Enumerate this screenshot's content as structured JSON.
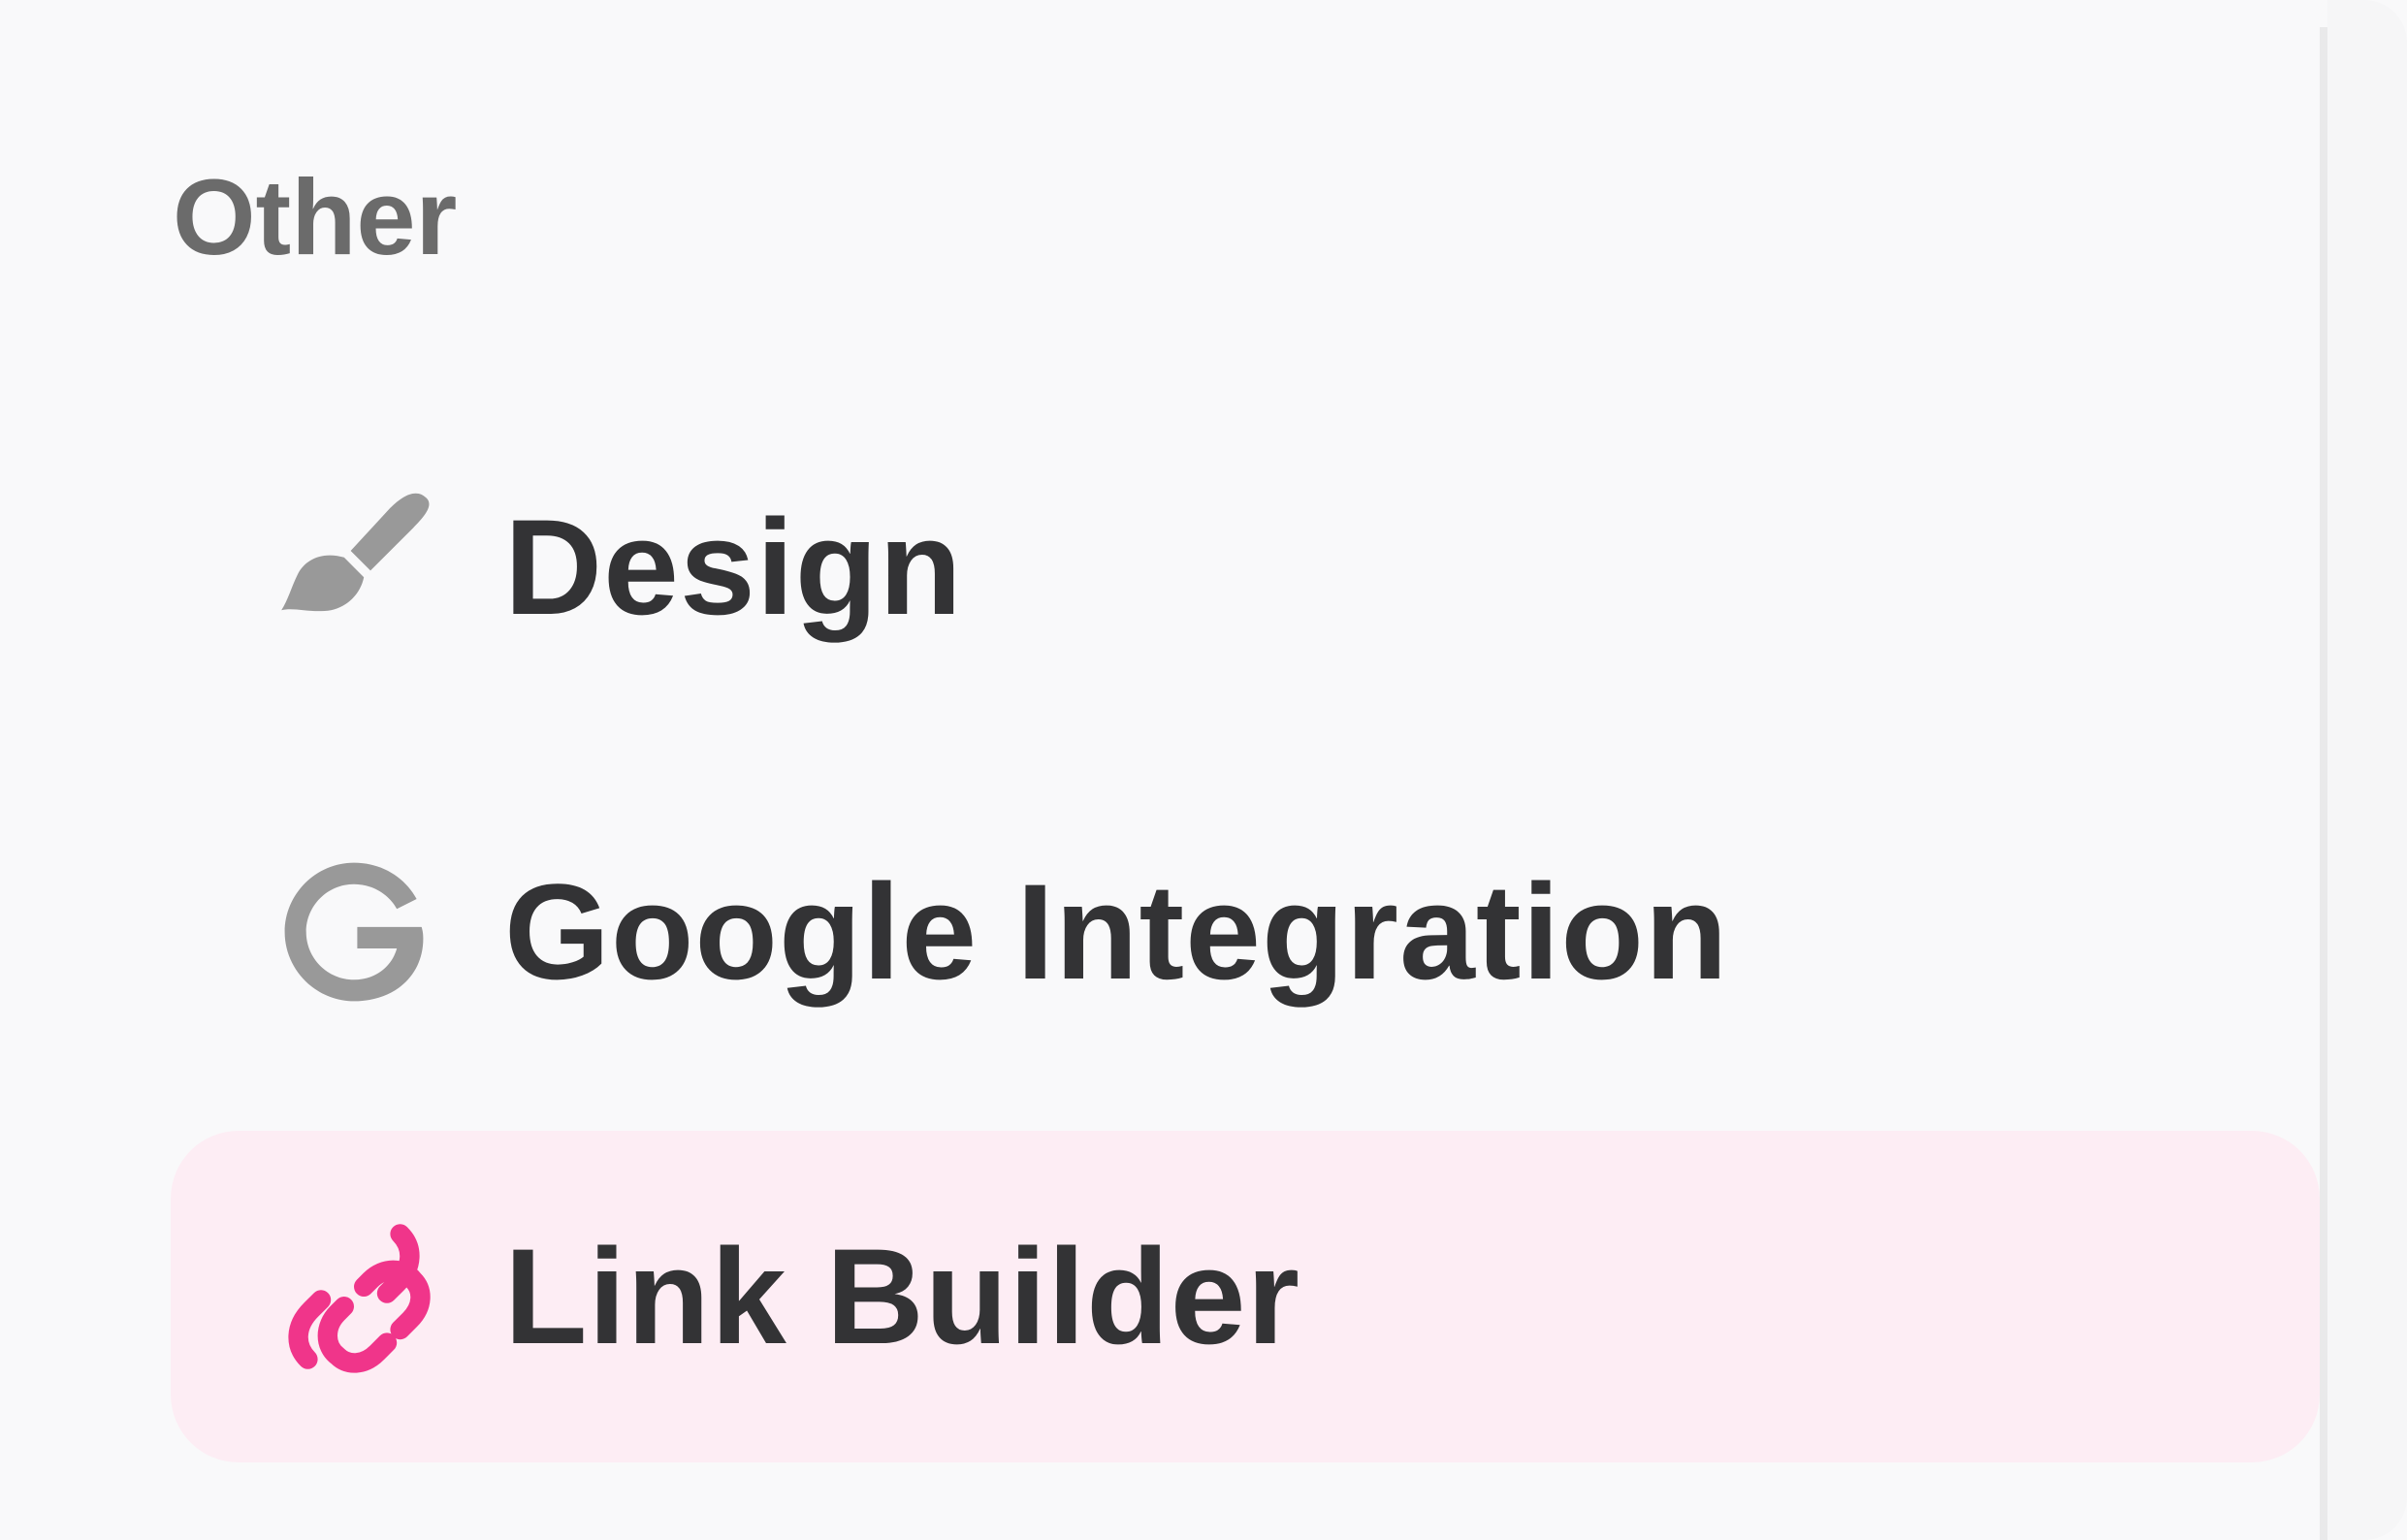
{
  "sidebar": {
    "section_title": "Other",
    "items": [
      {
        "label": "Design",
        "icon": "paintbrush-icon",
        "active": false
      },
      {
        "label": "Google Integration",
        "icon": "google-g-icon",
        "active": false
      },
      {
        "label": "Link Builder",
        "icon": "link-icon",
        "active": true
      }
    ]
  },
  "colors": {
    "background": "#f9f9fa",
    "icon_inactive": "#999999",
    "text": "#333335",
    "section_title": "#6b6b6b",
    "accent": "#f0358a",
    "active_bg": "#fdedf4"
  }
}
